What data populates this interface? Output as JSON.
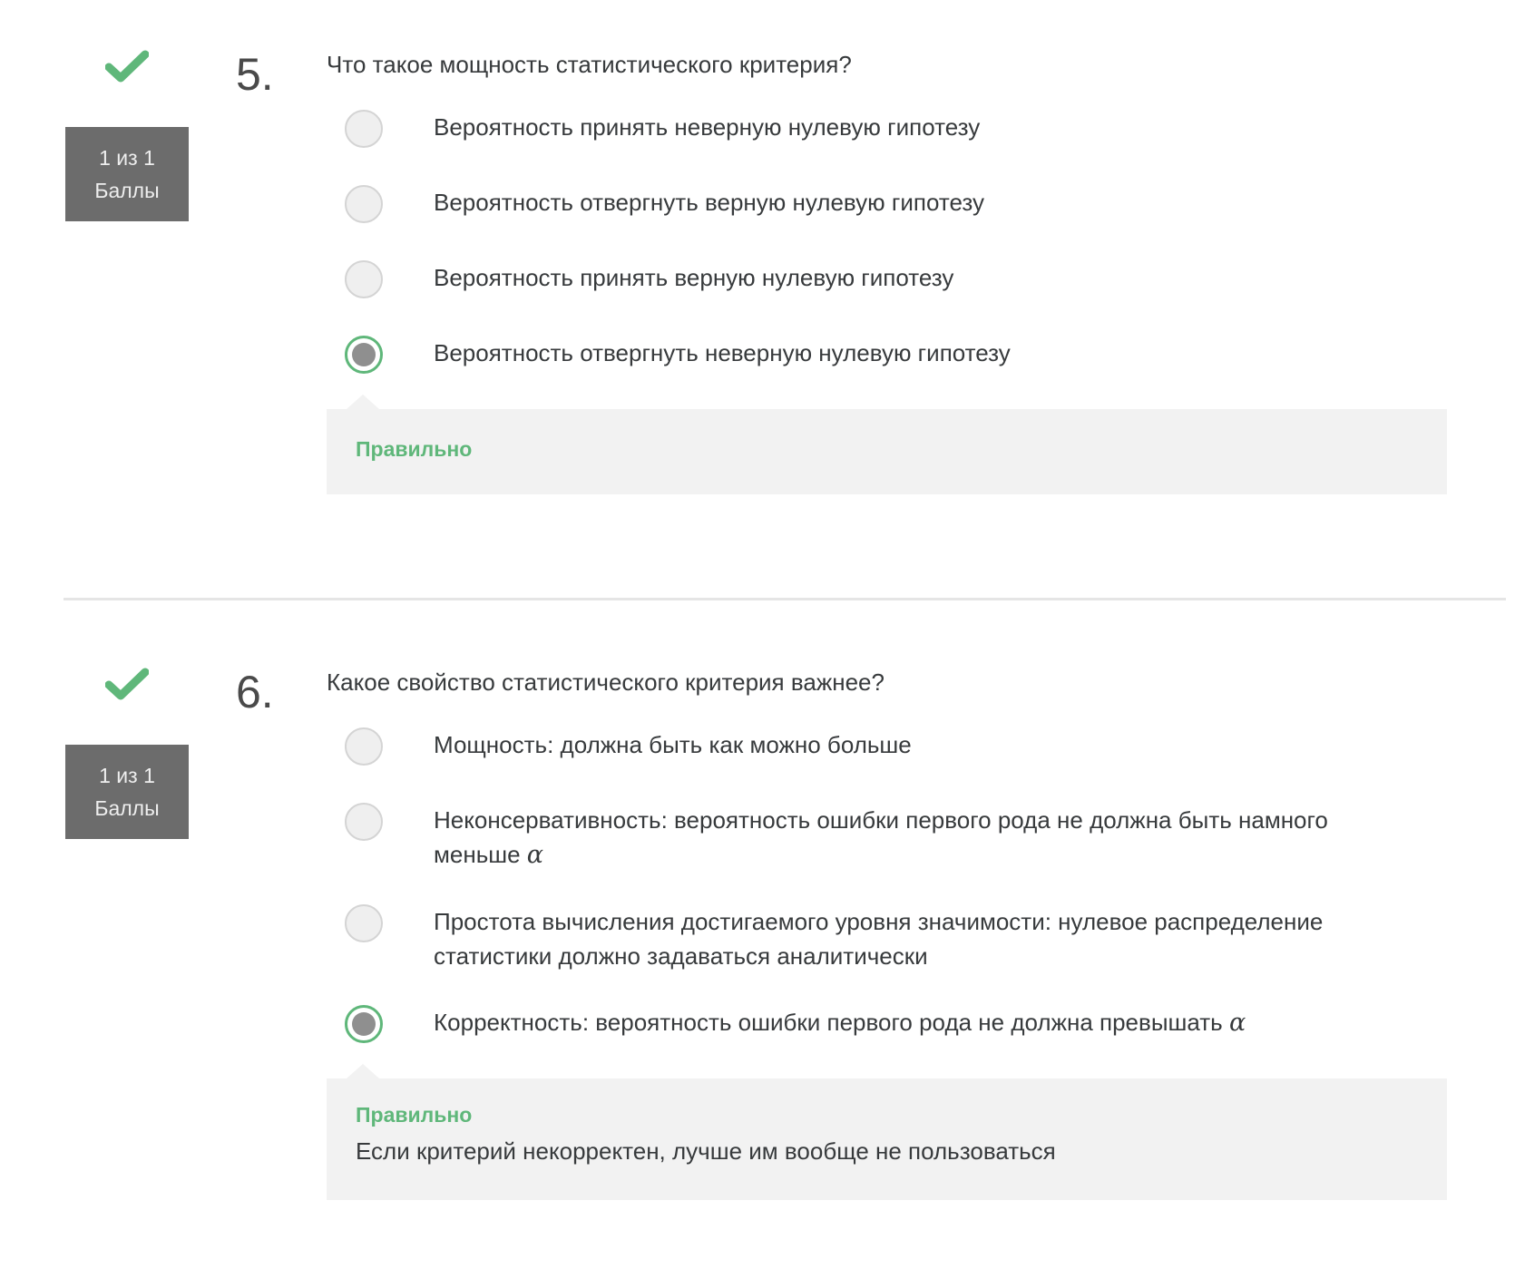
{
  "colors": {
    "correct": "#5fb77a",
    "score_bg": "#6c6c6c",
    "feedback_bg": "#f2f2f2"
  },
  "questions": [
    {
      "number": "5.",
      "status_icon": "check-icon",
      "score_line1": "1 из 1",
      "score_line2": "Баллы",
      "prompt": "Что такое мощность статистического критерия?",
      "options": [
        {
          "label": "Вероятность принять неверную нулевую гипотезу",
          "selected": false
        },
        {
          "label": "Вероятность отвергнуть верную нулевую гипотезу",
          "selected": false
        },
        {
          "label": "Вероятность принять верную нулевую гипотезу",
          "selected": false
        },
        {
          "label": "Вероятность отвергнуть неверную нулевую гипотезу",
          "selected": true
        }
      ],
      "feedback_title": "Правильно",
      "feedback_text": ""
    },
    {
      "number": "6.",
      "status_icon": "check-icon",
      "score_line1": "1 из 1",
      "score_line2": "Баллы",
      "prompt": "Какое свойство статистического критерия важнее?",
      "options": [
        {
          "label": "Мощность: должна быть как можно больше",
          "selected": false
        },
        {
          "label": "Неконсервативность: вероятность ошибки первого рода не должна быть намного меньше",
          "math": "α",
          "selected": false
        },
        {
          "label": "Простота вычисления достигаемого уровня значимости: нулевое распределение статистики должно задаваться аналитически",
          "selected": false
        },
        {
          "label": "Корректность: вероятность ошибки первого рода не должна превышать",
          "math": "α",
          "selected": true
        }
      ],
      "feedback_title": "Правильно",
      "feedback_text": "Если критерий некорректен, лучше им вообще не пользоваться"
    }
  ]
}
